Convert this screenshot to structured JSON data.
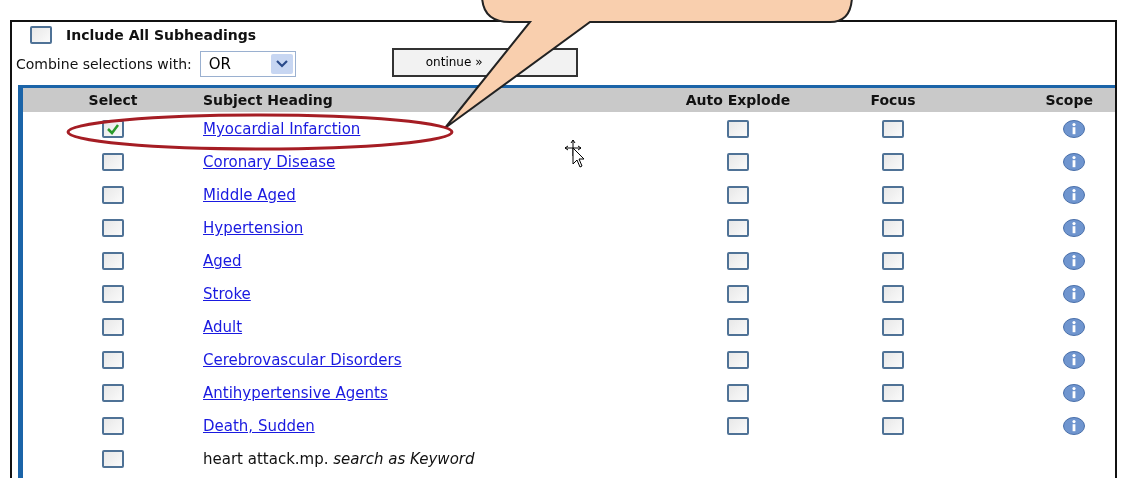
{
  "include_all_subheadings": {
    "label": "Include All Subheadings",
    "checked": false
  },
  "combine": {
    "label": "Combine selections with:",
    "value": "OR"
  },
  "continue_button": {
    "label": "ontinue »"
  },
  "table": {
    "columns": [
      "Select",
      "Subject Heading",
      "Auto Explode",
      "Focus",
      "Scope"
    ],
    "rows": [
      {
        "kind": "heading",
        "label": "Myocardial Infarction",
        "selected": true,
        "auto_explode": false,
        "focus": false
      },
      {
        "kind": "heading",
        "label": "Coronary Disease",
        "selected": false,
        "auto_explode": false,
        "focus": false
      },
      {
        "kind": "heading",
        "label": "Middle Aged",
        "selected": false,
        "auto_explode": false,
        "focus": false
      },
      {
        "kind": "heading",
        "label": "Hypertension",
        "selected": false,
        "auto_explode": false,
        "focus": false
      },
      {
        "kind": "heading",
        "label": "Aged",
        "selected": false,
        "auto_explode": false,
        "focus": false
      },
      {
        "kind": "heading",
        "label": "Stroke",
        "selected": false,
        "auto_explode": false,
        "focus": false
      },
      {
        "kind": "heading",
        "label": "Adult",
        "selected": false,
        "auto_explode": false,
        "focus": false
      },
      {
        "kind": "heading",
        "label": "Cerebrovascular Disorders",
        "selected": false,
        "auto_explode": false,
        "focus": false
      },
      {
        "kind": "heading",
        "label": "Antihypertensive Agents",
        "selected": false,
        "auto_explode": false,
        "focus": false
      },
      {
        "kind": "heading",
        "label": "Death, Sudden",
        "selected": false,
        "auto_explode": false,
        "focus": false
      },
      {
        "kind": "keyword",
        "label": "heart attack.mp. *search as Keyword*",
        "selected": false
      }
    ]
  }
}
